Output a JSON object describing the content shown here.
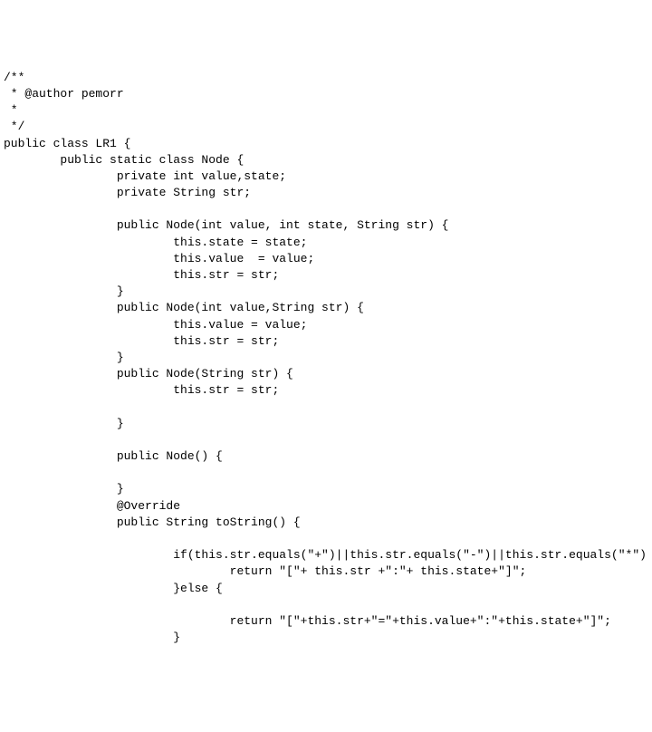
{
  "code_lines": [
    "/**",
    " * @author pemorr",
    " *",
    " */",
    "public class LR1 {",
    "        public static class Node {",
    "                private int value,state;",
    "                private String str;",
    "",
    "                public Node(int value, int state, String str) {",
    "                        this.state = state;",
    "                        this.value  = value;",
    "                        this.str = str;",
    "                }",
    "                public Node(int value,String str) {",
    "                        this.value = value;",
    "                        this.str = str;",
    "                }",
    "                public Node(String str) {",
    "                        this.str = str;",
    "",
    "                }",
    "",
    "                public Node() {",
    "",
    "                }",
    "                @Override",
    "                public String toString() {",
    "",
    "                        if(this.str.equals(\"+\")||this.str.equals(\"-\")||this.str.equals(\"*\")",
    "                                return \"[\"+ this.str +\":\"+ this.state+\"]\";",
    "                        }else {",
    "",
    "                                return \"[\"+this.str+\"=\"+this.value+\":\"+this.state+\"]\";",
    "                        }"
  ]
}
